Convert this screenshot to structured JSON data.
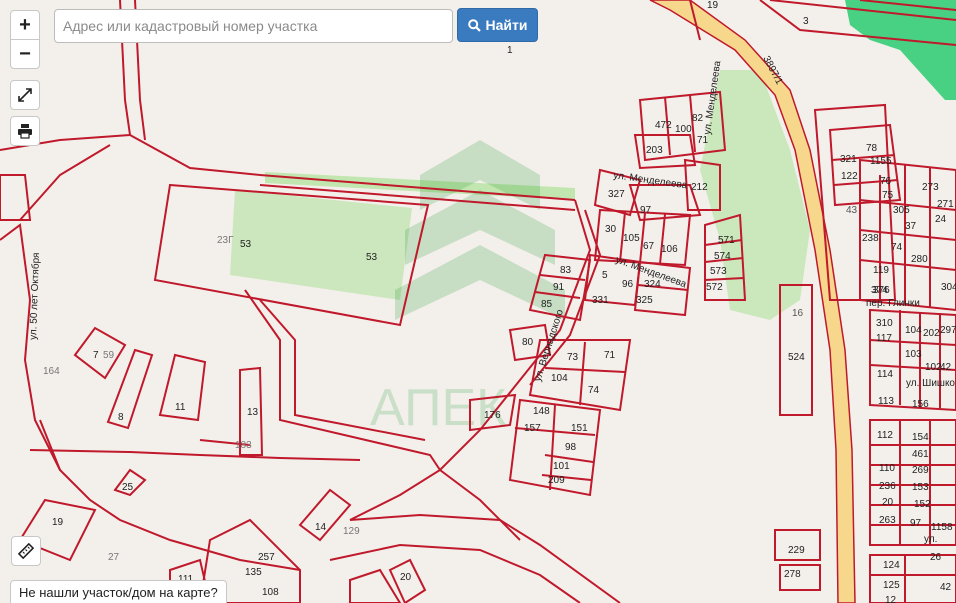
{
  "search": {
    "placeholder": "Адрес или кадастровый номер участка",
    "button_label": "Найти"
  },
  "controls": {
    "zoom_in": "+",
    "zoom_out": "−"
  },
  "footer_link": "Не нашли участок/дом на карте?",
  "watermark": {
    "text": "АПЕК"
  },
  "street_labels": {
    "mendeleeva_1": "ул. Менделеева",
    "mendeleeva_2": "ул. Менделеева",
    "mendeleeva_3": "ул. Менделеева",
    "oktyabrya": "ул. 50 лет Октября",
    "road_number": "3897/1",
    "glinki": "пер. Глинки",
    "shishkova": "ул. Шишко",
    "street_short": "ул.",
    "vernadskogo": "ул. Вернадского"
  },
  "colors": {
    "parcel_line": "#c0192b",
    "road_fill": "#f5d58a",
    "green_area": "#b7e2a8",
    "forest": "#3fcf7a",
    "button": "#3a7bc0"
  },
  "parcel_labels": [
    "19",
    "3",
    "1",
    "472",
    "100",
    "82",
    "71",
    "203",
    "327",
    "97",
    "212",
    "30",
    "105",
    "67",
    "106",
    "571",
    "574",
    "573",
    "572",
    "83",
    "91",
    "85",
    "5",
    "96",
    "324",
    "325",
    "331",
    "80",
    "73",
    "71",
    "104",
    "74",
    "176",
    "148",
    "157",
    "151",
    "98",
    "101",
    "209",
    "53",
    "53",
    "23Г",
    "7",
    "59",
    "164",
    "8",
    "11",
    "13",
    "183",
    "25",
    "19",
    "14",
    "129",
    "20",
    "135",
    "257",
    "108",
    "111",
    "27",
    "321",
    "1155",
    "78",
    "122",
    "76",
    "75",
    "273",
    "305",
    "271",
    "37",
    "238",
    "43",
    "24",
    "280",
    "119",
    "374",
    "376",
    "304",
    "16",
    "524",
    "310",
    "104",
    "202",
    "297",
    "117",
    "103",
    "102",
    "114",
    "113",
    "156",
    "112",
    "154",
    "461",
    "110",
    "269",
    "236",
    "153",
    "20",
    "152",
    "263",
    "97",
    "1158",
    "229",
    "278",
    "124",
    "125",
    "42",
    "12",
    "26"
  ]
}
